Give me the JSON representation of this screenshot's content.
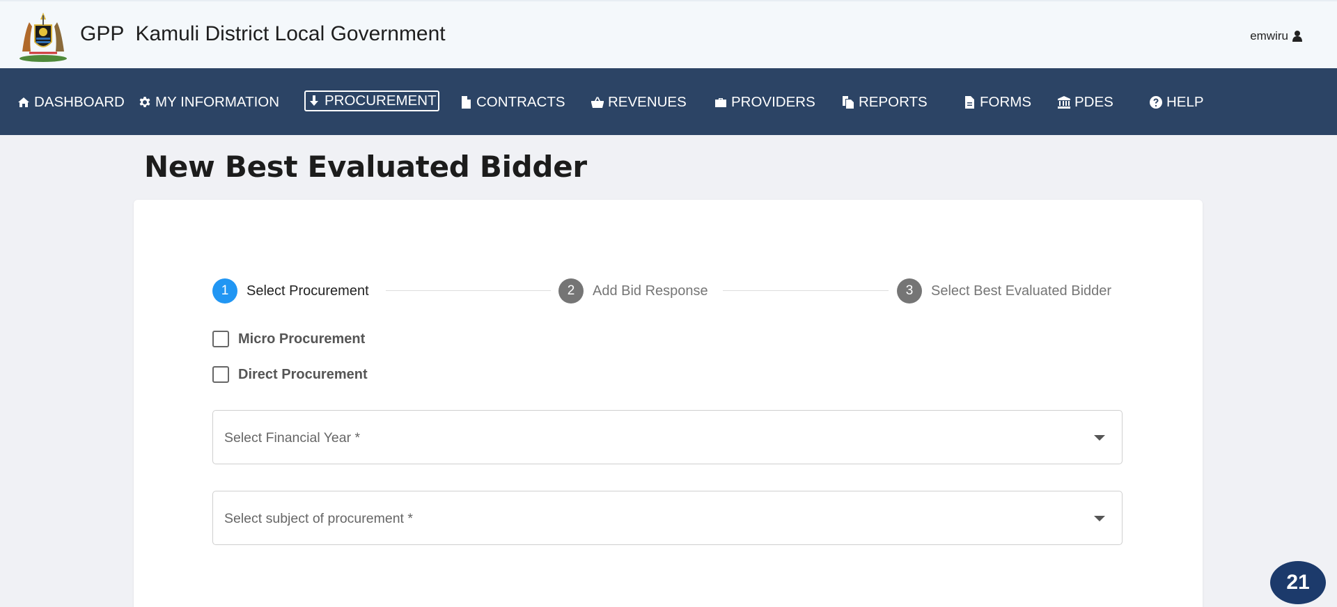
{
  "header": {
    "brand_short": "GPP",
    "brand_org": "Kamuli District Local Government",
    "username": "emwiru"
  },
  "nav": {
    "items": [
      {
        "label": "DASHBOARD",
        "icon": "home-icon"
      },
      {
        "label": "MY INFORMATION",
        "icon": "gear-icon"
      },
      {
        "label": "PROCUREMENT",
        "icon": "download-arrow-icon",
        "active": true
      },
      {
        "label": "CONTRACTS",
        "icon": "file-icon"
      },
      {
        "label": "REVENUES",
        "icon": "basket-icon"
      },
      {
        "label": "PROVIDERS",
        "icon": "briefcase-icon"
      },
      {
        "label": "REPORTS",
        "icon": "copy-icon"
      },
      {
        "label": "FORMS",
        "icon": "file-text-icon"
      },
      {
        "label": "PDES",
        "icon": "bank-icon"
      },
      {
        "label": "HELP",
        "icon": "question-circle-icon"
      }
    ]
  },
  "page": {
    "title": "New Best Evaluated Bidder"
  },
  "stepper": {
    "steps": [
      {
        "number": "1",
        "label": "Select Procurement",
        "current": true
      },
      {
        "number": "2",
        "label": "Add Bid Response",
        "current": false
      },
      {
        "number": "3",
        "label": "Select Best Evaluated Bidder",
        "current": false
      }
    ]
  },
  "form": {
    "micro_label": "Micro Procurement",
    "direct_label": "Direct Procurement",
    "financial_year_placeholder": "Select Financial Year *",
    "subject_placeholder": "Select subject of procurement *"
  },
  "badge": {
    "count": "21"
  },
  "colors": {
    "nav_bg": "#2c4465",
    "step_active": "#2196f3",
    "step_inactive": "#757575",
    "badge_bg": "#1c3a6b"
  }
}
